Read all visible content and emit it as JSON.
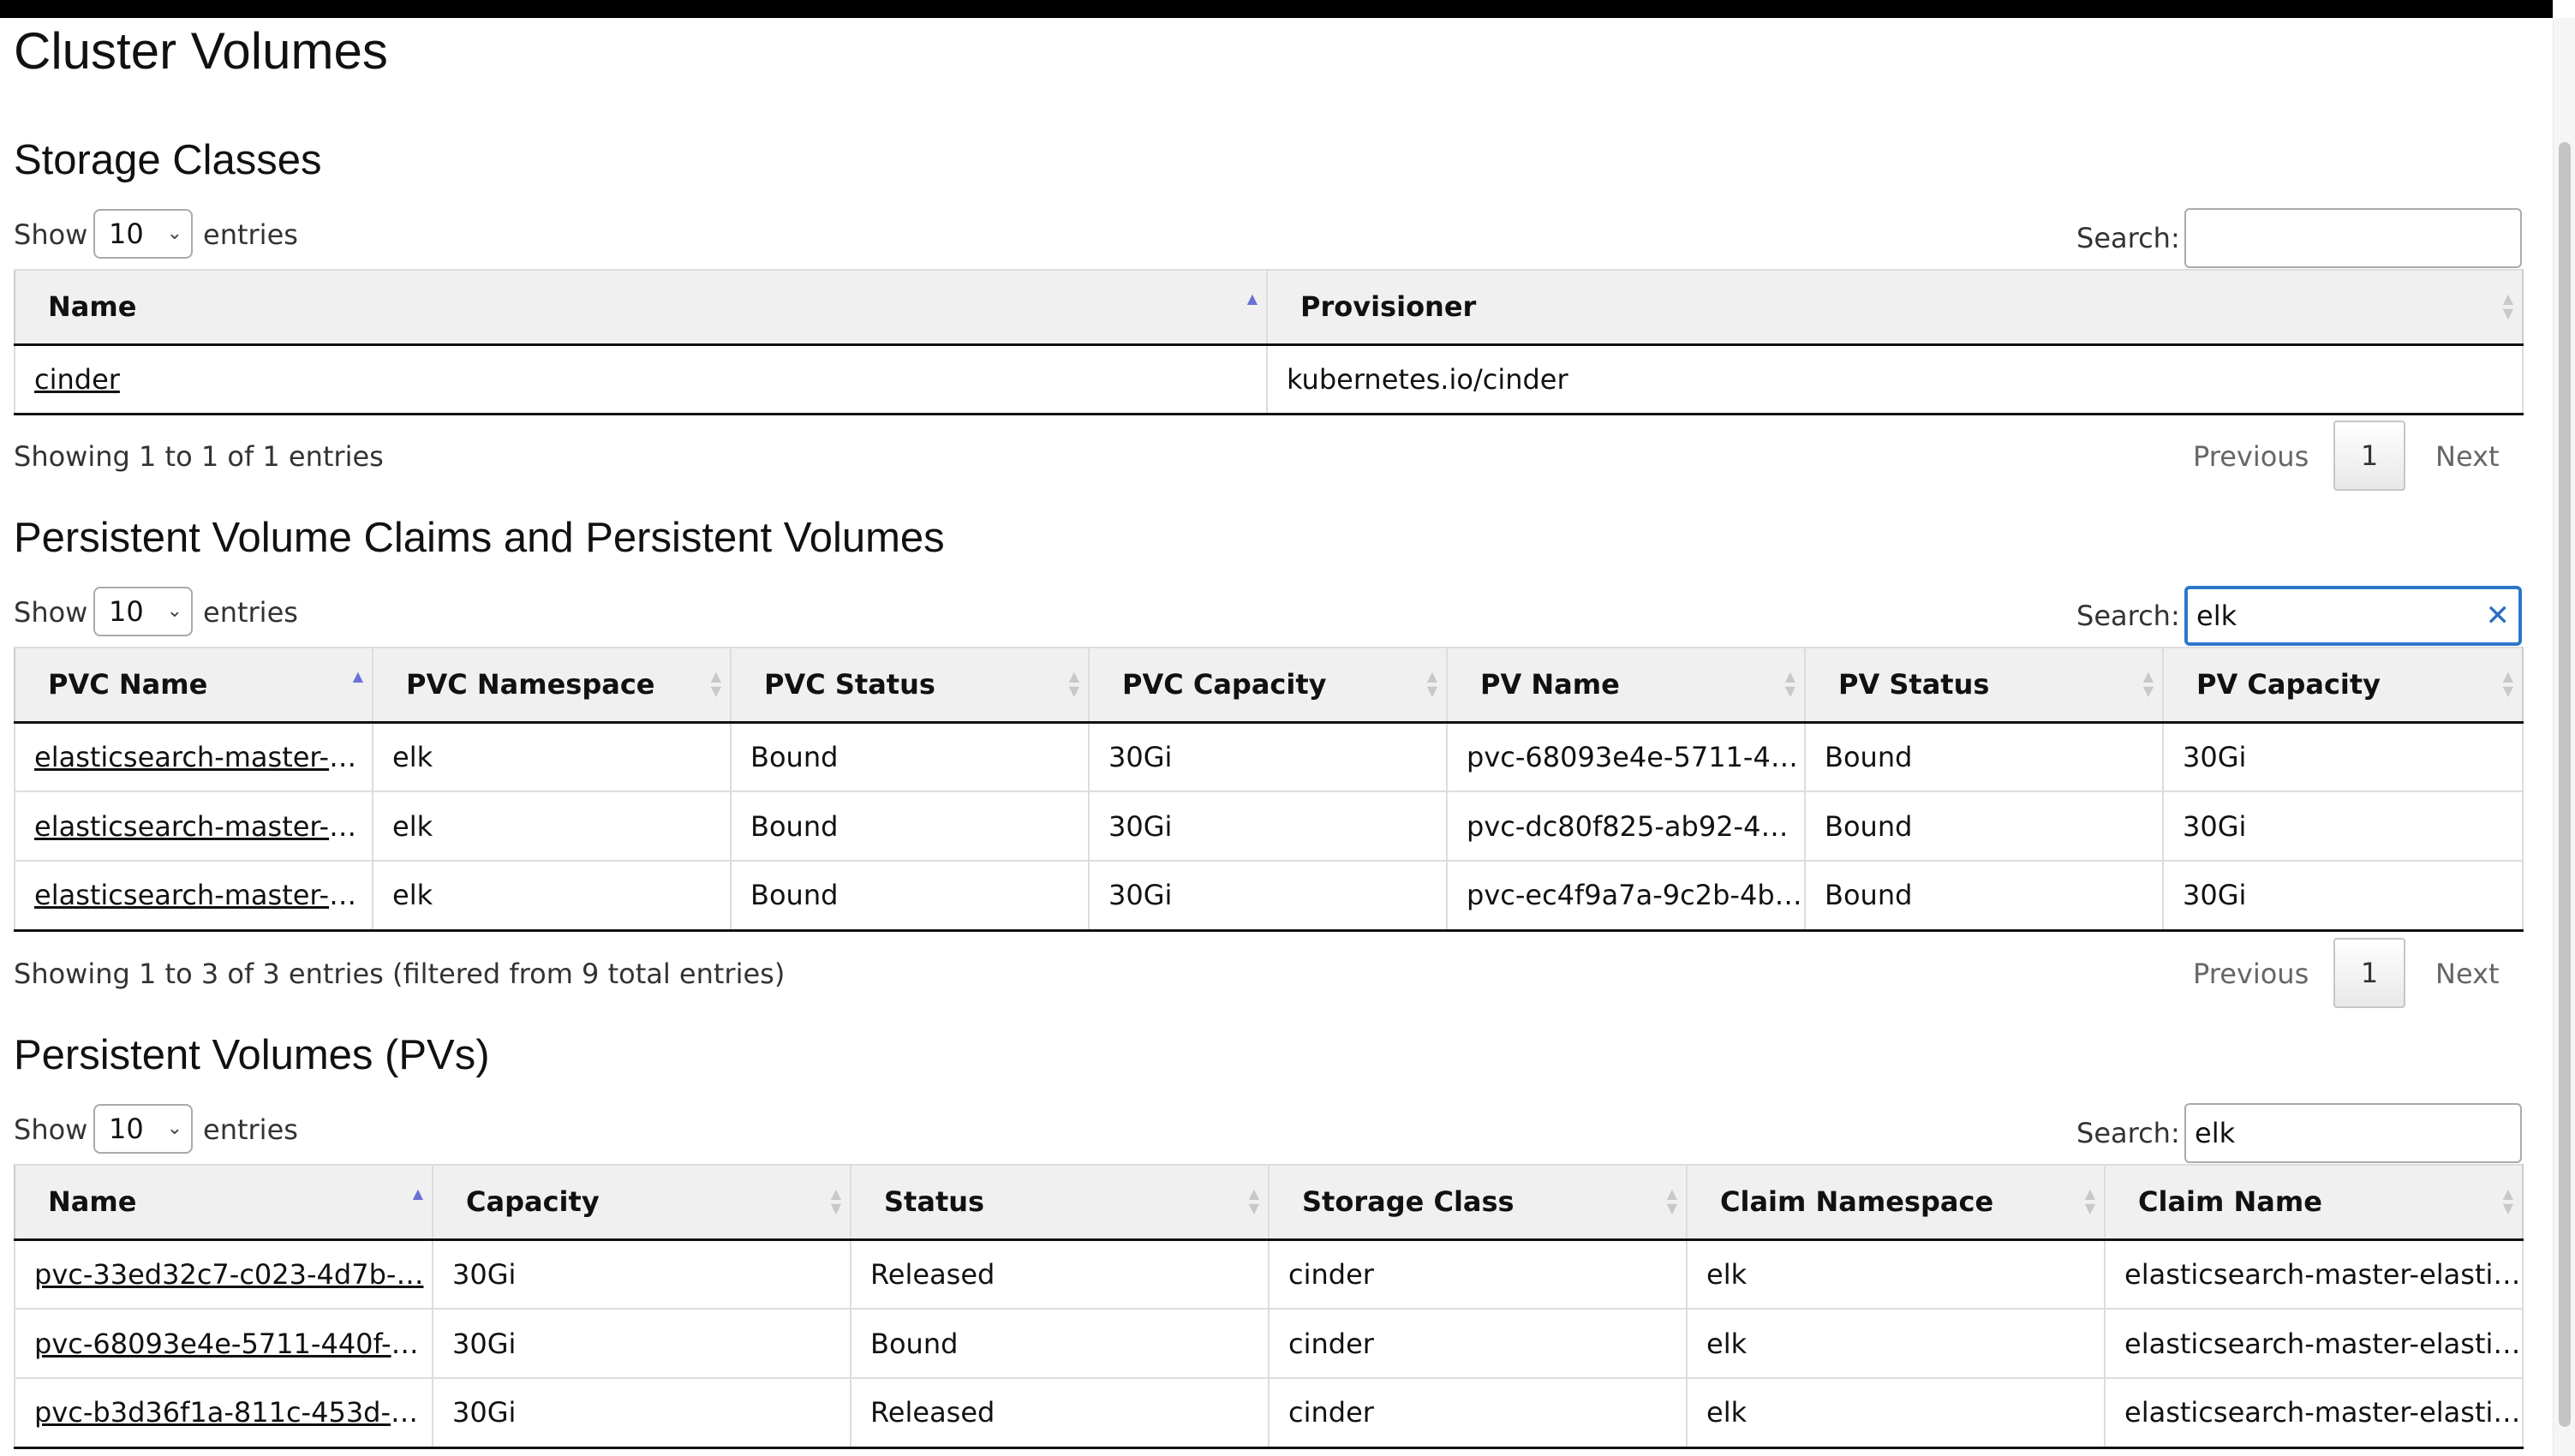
{
  "page": {
    "title": "Cluster Volumes"
  },
  "storage_classes": {
    "heading": "Storage Classes",
    "show_label": "Show",
    "length": "10",
    "entries_label": "entries",
    "search_label": "Search:",
    "search_value": "",
    "columns": [
      "Name",
      "Provisioner"
    ],
    "rows": [
      [
        "cinder",
        "kubernetes.io/cinder"
      ]
    ],
    "info": "Showing 1 to 1 of 1 entries",
    "prev": "Previous",
    "page": "1",
    "next": "Next"
  },
  "pvc_pv": {
    "heading": "Persistent Volume Claims and Persistent Volumes",
    "show_label": "Show",
    "length": "10",
    "entries_label": "entries",
    "search_label": "Search:",
    "search_value": "elk",
    "columns": [
      "PVC Name",
      "PVC Namespace",
      "PVC Status",
      "PVC Capacity",
      "PV Name",
      "PV Status",
      "PV Capacity"
    ],
    "rows": [
      [
        "elasticsearch-master-e…",
        "elk",
        "Bound",
        "30Gi",
        "pvc-68093e4e-5711-4…",
        "Bound",
        "30Gi"
      ],
      [
        "elasticsearch-master-e…",
        "elk",
        "Bound",
        "30Gi",
        "pvc-dc80f825-ab92-48…",
        "Bound",
        "30Gi"
      ],
      [
        "elasticsearch-master-e…",
        "elk",
        "Bound",
        "30Gi",
        "pvc-ec4f9a7a-9c2b-4b…",
        "Bound",
        "30Gi"
      ]
    ],
    "info": "Showing 1 to 3 of 3 entries (filtered from 9 total entries)",
    "prev": "Previous",
    "page": "1",
    "next": "Next"
  },
  "pvs": {
    "heading": "Persistent Volumes (PVs)",
    "show_label": "Show",
    "length": "10",
    "entries_label": "entries",
    "search_label": "Search:",
    "search_value": "elk",
    "columns": [
      "Name",
      "Capacity",
      "Status",
      "Storage Class",
      "Claim Namespace",
      "Claim Name"
    ],
    "rows": [
      [
        "pvc-33ed32c7-c023-4d7b-…",
        "30Gi",
        "Released",
        "cinder",
        "elk",
        "elasticsearch-master-elasti…"
      ],
      [
        "pvc-68093e4e-5711-440f-a…",
        "30Gi",
        "Bound",
        "cinder",
        "elk",
        "elasticsearch-master-elasti…"
      ],
      [
        "pvc-b3d36f1a-811c-453d-b…",
        "30Gi",
        "Released",
        "cinder",
        "elk",
        "elasticsearch-master-elasti…"
      ]
    ]
  }
}
